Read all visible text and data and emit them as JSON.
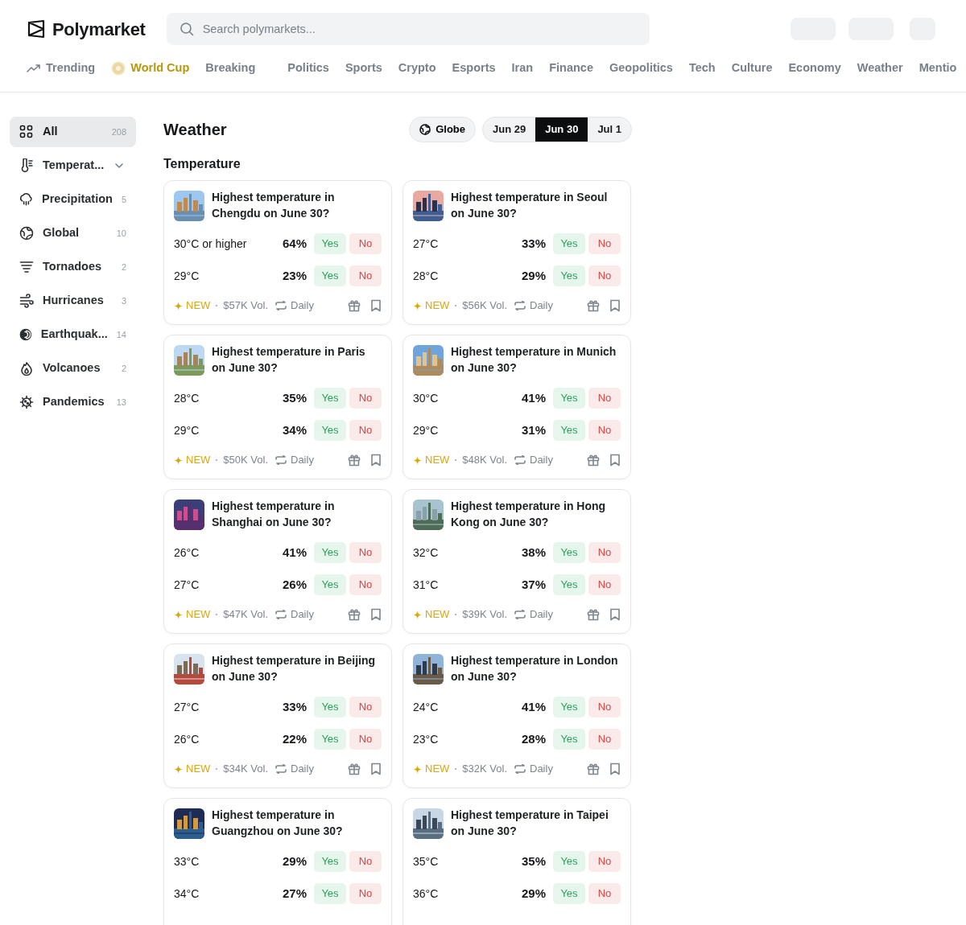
{
  "header": {
    "logo": "Polymarket",
    "search": {
      "placeholder": "Search polymarkets..."
    }
  },
  "nav": [
    {
      "label": "Trending",
      "kind": "trend"
    },
    {
      "label": "World Cup",
      "kind": "featured"
    },
    {
      "label": "Breaking",
      "kind": "plain"
    },
    {
      "kind": "separator"
    },
    {
      "label": "Politics",
      "kind": "plain"
    },
    {
      "label": "Sports",
      "kind": "plain"
    },
    {
      "label": "Crypto",
      "kind": "plain"
    },
    {
      "label": "Esports",
      "kind": "plain"
    },
    {
      "label": "Iran",
      "kind": "plain"
    },
    {
      "label": "Finance",
      "kind": "plain"
    },
    {
      "label": "Geopolitics",
      "kind": "plain"
    },
    {
      "label": "Tech",
      "kind": "plain"
    },
    {
      "label": "Culture",
      "kind": "plain"
    },
    {
      "label": "Economy",
      "kind": "plain"
    },
    {
      "label": "Weather",
      "kind": "plain"
    },
    {
      "label": "Mentio",
      "kind": "plain"
    }
  ],
  "sidebar": {
    "items": [
      {
        "label": "All",
        "count": "208",
        "selected": true,
        "expandable": false
      },
      {
        "label": "Temperat...",
        "selected": false,
        "expandable": true
      },
      {
        "label": "Precipitation",
        "count": "5",
        "selected": false,
        "expandable": false
      },
      {
        "label": "Global",
        "count": "10",
        "selected": false,
        "expandable": false
      },
      {
        "label": "Tornadoes",
        "count": "2",
        "selected": false,
        "expandable": false
      },
      {
        "label": "Hurricanes",
        "count": "3",
        "selected": false,
        "expandable": false
      },
      {
        "label": "Earthquak...",
        "count": "14",
        "selected": false,
        "expandable": false
      },
      {
        "label": "Volcanoes",
        "count": "2",
        "selected": false,
        "expandable": false
      },
      {
        "label": "Pandemics",
        "count": "13",
        "selected": false,
        "expandable": false
      }
    ]
  },
  "page": {
    "title": "Weather",
    "globe_button": "Globe",
    "dates": [
      {
        "label": "Jun 29",
        "selected": false
      },
      {
        "label": "Jun 30",
        "selected": true
      },
      {
        "label": "Jul 1",
        "selected": false
      }
    ]
  },
  "section": {
    "title": "Temperature"
  },
  "markets": [
    {
      "title": "Highest temperature in Chengdu on June 30?",
      "outcomes": [
        {
          "label": "30°C or higher",
          "chance": "64%",
          "yes": "Yes",
          "no": "No"
        },
        {
          "label": "29°C",
          "chance": "23%",
          "yes": "Yes",
          "no": "No"
        }
      ],
      "badge": "NEW",
      "volume": "$57K Vol.",
      "recurrence": "Daily"
    },
    {
      "title": "Highest temperature in Seoul on June 30?",
      "outcomes": [
        {
          "label": "27°C",
          "chance": "33%",
          "yes": "Yes",
          "no": "No"
        },
        {
          "label": "28°C",
          "chance": "29%",
          "yes": "Yes",
          "no": "No"
        }
      ],
      "badge": "NEW",
      "volume": "$56K Vol.",
      "recurrence": "Daily"
    },
    {
      "title": "Highest temperature in Paris on June 30?",
      "outcomes": [
        {
          "label": "28°C",
          "chance": "35%",
          "yes": "Yes",
          "no": "No"
        },
        {
          "label": "29°C",
          "chance": "34%",
          "yes": "Yes",
          "no": "No"
        }
      ],
      "badge": "NEW",
      "volume": "$50K Vol.",
      "recurrence": "Daily"
    },
    {
      "title": "Highest temperature in Munich on June 30?",
      "outcomes": [
        {
          "label": "30°C",
          "chance": "41%",
          "yes": "Yes",
          "no": "No"
        },
        {
          "label": "29°C",
          "chance": "31%",
          "yes": "Yes",
          "no": "No"
        }
      ],
      "badge": "NEW",
      "volume": "$48K Vol.",
      "recurrence": "Daily"
    },
    {
      "title": "Highest temperature in Shanghai on June 30?",
      "outcomes": [
        {
          "label": "26°C",
          "chance": "41%",
          "yes": "Yes",
          "no": "No"
        },
        {
          "label": "27°C",
          "chance": "26%",
          "yes": "Yes",
          "no": "No"
        }
      ],
      "badge": "NEW",
      "volume": "$47K Vol.",
      "recurrence": "Daily"
    },
    {
      "title": "Highest temperature in Hong Kong on June 30?",
      "outcomes": [
        {
          "label": "32°C",
          "chance": "38%",
          "yes": "Yes",
          "no": "No"
        },
        {
          "label": "31°C",
          "chance": "37%",
          "yes": "Yes",
          "no": "No"
        }
      ],
      "badge": "NEW",
      "volume": "$39K Vol.",
      "recurrence": "Daily"
    },
    {
      "title": "Highest temperature in Beijing on June 30?",
      "outcomes": [
        {
          "label": "27°C",
          "chance": "33%",
          "yes": "Yes",
          "no": "No"
        },
        {
          "label": "26°C",
          "chance": "22%",
          "yes": "Yes",
          "no": "No"
        }
      ],
      "badge": "NEW",
      "volume": "$34K Vol.",
      "recurrence": "Daily"
    },
    {
      "title": "Highest temperature in London on June 30?",
      "outcomes": [
        {
          "label": "24°C",
          "chance": "41%",
          "yes": "Yes",
          "no": "No"
        },
        {
          "label": "23°C",
          "chance": "28%",
          "yes": "Yes",
          "no": "No"
        }
      ],
      "badge": "NEW",
      "volume": "$32K Vol.",
      "recurrence": "Daily"
    },
    {
      "title": "Highest temperature in Guangzhou on June 30?",
      "outcomes": [
        {
          "label": "33°C",
          "chance": "29%",
          "yes": "Yes",
          "no": "No"
        },
        {
          "label": "34°C",
          "chance": "27%",
          "yes": "Yes",
          "no": "No"
        }
      ]
    },
    {
      "title": "Highest temperature in Taipei on June 30?",
      "outcomes": [
        {
          "label": "35°C",
          "chance": "35%",
          "yes": "Yes",
          "no": "No"
        },
        {
          "label": "36°C",
          "chance": "29%",
          "yes": "Yes",
          "no": "No"
        }
      ]
    }
  ]
}
